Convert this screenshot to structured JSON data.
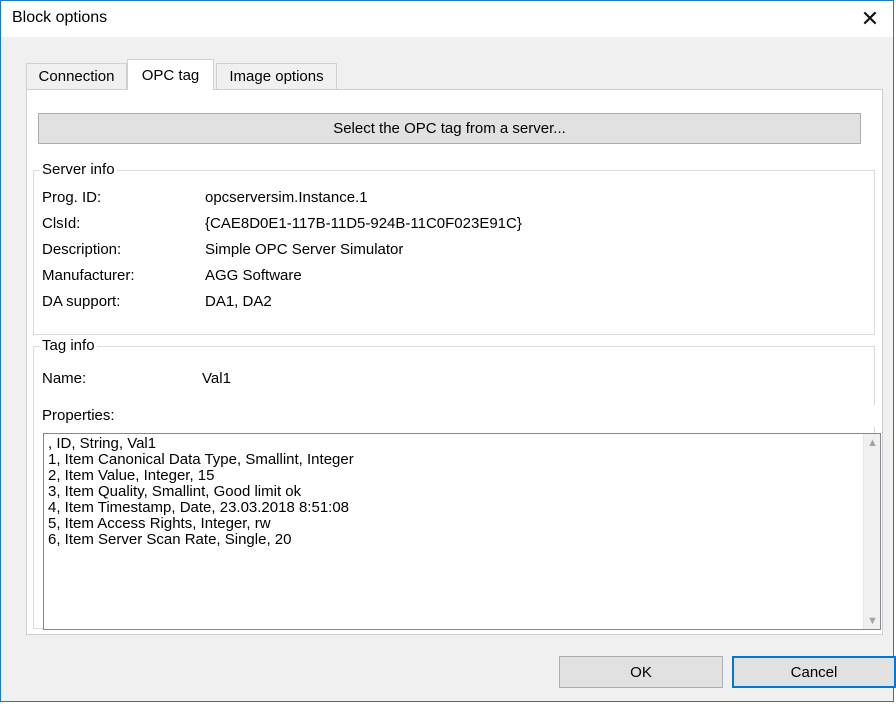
{
  "window": {
    "title": "Block options",
    "close_icon": "close-icon"
  },
  "tabs": [
    {
      "label": "Connection",
      "active": false
    },
    {
      "label": "OPC tag",
      "active": true
    },
    {
      "label": "Image options",
      "active": false
    }
  ],
  "select_button": "Select the OPC tag from a server...",
  "server_info": {
    "legend": "Server info",
    "rows": [
      {
        "label": "Prog. ID:",
        "value": "opcserversim.Instance.1"
      },
      {
        "label": "ClsId:",
        "value": "{CAE8D0E1-117B-11D5-924B-11C0F023E91C}"
      },
      {
        "label": "Description:",
        "value": "Simple OPC Server Simulator"
      },
      {
        "label": "Manufacturer:",
        "value": "AGG Software"
      },
      {
        "label": "DA support:",
        "value": "DA1, DA2"
      }
    ]
  },
  "tag_info": {
    "legend": "Tag info",
    "name_label": "Name:",
    "name_value": "Val1",
    "properties_label": "Properties:",
    "properties": [
      ", ID, String, Val1",
      "1, Item Canonical Data Type, Smallint, Integer",
      "2, Item Value, Integer, 15",
      "3, Item Quality, Smallint, Good limit ok",
      "4, Item Timestamp, Date, 23.03.2018 8:51:08",
      "5, Item Access Rights, Integer, rw",
      "6, Item Server Scan Rate, Single, 20"
    ]
  },
  "buttons": {
    "ok": "OK",
    "cancel": "Cancel"
  },
  "colors": {
    "accent": "#0078d7",
    "window_border": "#1979ca"
  }
}
